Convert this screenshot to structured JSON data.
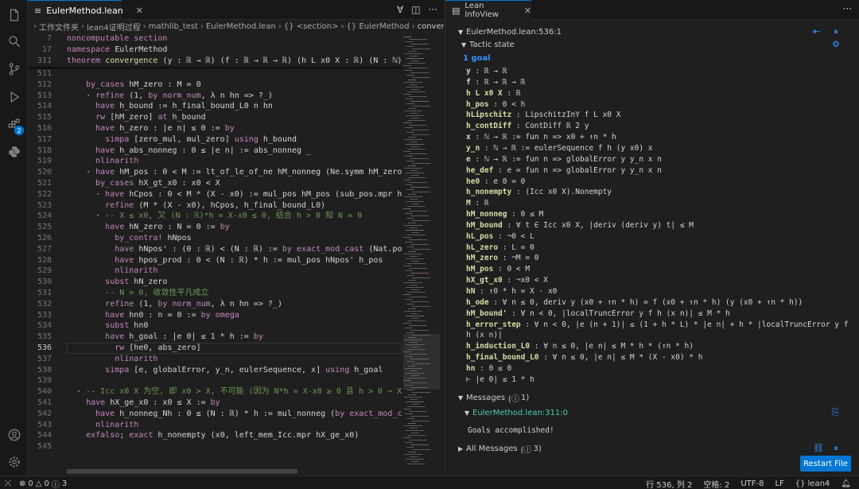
{
  "editor": {
    "tab_label": "EulerMethod.lean",
    "breadcrumb": [
      "工作文件夹",
      "lean4证明过程",
      "mathlib_test",
      "EulerMethod.lean",
      "{} <section>",
      "{} EulerMethod",
      "convergence"
    ],
    "sticky_lines": [
      {
        "n": "7",
        "html": "<span class=\"kw\">noncomputable section</span>"
      },
      {
        "n": "17",
        "html": "<span class=\"kw\">namespace</span> EulerMethod"
      },
      {
        "n": "311",
        "html": "<span class=\"kw\">theorem</span> <span class=\"fn\">convergence</span> (y : ℝ → ℝ) (f : ℝ → ℝ → ℝ) (h L x0 X : ℝ) (N : ℕ)"
      }
    ],
    "active_line": "536",
    "lines": [
      {
        "n": "511",
        "html": ""
      },
      {
        "n": "512",
        "html": "    <span class=\"kw\">by_cases</span> hM_zero : M = 0"
      },
      {
        "n": "513",
        "html": "    · <span class=\"kw\">refine</span> (1, <span class=\"kw\">by</span> <span class=\"kw\">norm_num</span>, λ n hn => ?_)"
      },
      {
        "n": "514",
        "html": "      <span class=\"kw\">have</span> h_bound := h_final_bound_L0 n hn"
      },
      {
        "n": "515",
        "html": "      <span class=\"kw\">rw</span> [hM_zero] <span class=\"kw\">at</span> h_bound"
      },
      {
        "n": "516",
        "html": "      <span class=\"kw\">have</span> h_zero : |e n| ≤ 0 := <span class=\"kw\">by</span>"
      },
      {
        "n": "517",
        "html": "        <span class=\"kw\">simpa</span> [zero_mul, mul_zero] <span class=\"kw\">using</span> h_bound"
      },
      {
        "n": "518",
        "html": "      <span class=\"kw\">have</span> h_abs_nonneg : 0 ≤ |e n| := abs_nonneg _"
      },
      {
        "n": "519",
        "html": "      <span class=\"kw\">nlinarith</span>"
      },
      {
        "n": "520",
        "html": "    · <span class=\"kw\">have</span> hM_pos : 0 < M := lt_of_le_of_ne hM_nonneg (Ne.symm hM_zero)"
      },
      {
        "n": "521",
        "html": "      <span class=\"kw\">by_cases</span> hX_gt_x0 : x0 < X"
      },
      {
        "n": "522",
        "html": "      · <span class=\"kw\">have</span> hCpos : 0 < M * (X - x0) := mul_pos hM_pos (sub_pos.mpr hX_gt"
      },
      {
        "n": "523",
        "html": "        <span class=\"kw\">refine</span> (M * (X - x0), hCpos, h_final_bound_L0)"
      },
      {
        "n": "524",
        "html": "      · <span class=\"cm\">-- X ≤ x0, 又 (N : ℝ)*h = X-x0 ≤ 0, 结合 h > 0 知 N = 0</span>"
      },
      {
        "n": "525",
        "html": "        <span class=\"kw\">have</span> hN_zero : N = 0 := <span class=\"kw\">by</span>"
      },
      {
        "n": "526",
        "html": "          <span class=\"kw\">by_contra!</span> hNpos"
      },
      {
        "n": "527",
        "html": "          <span class=\"kw\">have</span> hNpos' : (0 : ℝ) < (N : ℝ) := <span class=\"kw\">by</span> <span class=\"kw\">exact_mod_cast</span> (Nat.pos_o"
      },
      {
        "n": "528",
        "html": "          <span class=\"kw\">have</span> hpos_prod : 0 < (N : ℝ) * h := mul_pos hNpos' h_pos"
      },
      {
        "n": "529",
        "html": "          <span class=\"kw\">nlinarith</span>"
      },
      {
        "n": "530",
        "html": "        <span class=\"kw\">subst</span> hN_zero"
      },
      {
        "n": "531",
        "html": "        <span class=\"cm\">-- N = 0, 收敛性平凡成立</span>"
      },
      {
        "n": "532",
        "html": "        <span class=\"kw\">refine</span> (1, <span class=\"kw\">by</span> <span class=\"kw\">norm_num</span>, λ n hn => ?_)"
      },
      {
        "n": "533",
        "html": "        <span class=\"kw\">have</span> hn0 : n = 0 := <span class=\"kw\">by</span> <span class=\"kw\">omega</span>"
      },
      {
        "n": "534",
        "html": "        <span class=\"kw\">subst</span> hn0"
      },
      {
        "n": "535",
        "html": "        <span class=\"kw\">have</span> h_goal : |e 0| ≤ 1 * h := <span class=\"kw\">by</span>"
      },
      {
        "n": "536",
        "html": "          <span class=\"kw\">rw</span> [he0, abs_zero]"
      },
      {
        "n": "537",
        "html": "          <span class=\"kw\">nlinarith</span>"
      },
      {
        "n": "538",
        "html": "        <span class=\"kw\">simpa</span> [e, globalError, y_n, eulerSequence, x] <span class=\"kw\">using</span> h_goal"
      },
      {
        "n": "539",
        "html": ""
      },
      {
        "n": "540",
        "html": "  · <span class=\"cm\">-- Icc x0 X 为空, 即 x0 > X, 不可能 (因为 N*h = X-x0 ≥ 0 且 h > 0 ⇒ X ≥ x</span>"
      },
      {
        "n": "541",
        "html": "    <span class=\"kw\">have</span> hX_ge_x0 : x0 ≤ X := <span class=\"kw\">by</span>"
      },
      {
        "n": "542",
        "html": "      <span class=\"kw\">have</span> h_nonneg_Nh : 0 ≤ (N : ℝ) * h := mul_nonneg (<span class=\"kw\">by</span> <span class=\"kw\">exact_mod_cast</span> Na"
      },
      {
        "n": "543",
        "html": "      <span class=\"kw\">nlinarith</span>"
      },
      {
        "n": "544",
        "html": "    <span class=\"kw\">exfalso</span>; <span class=\"kw\">exact</span> h_nonempty (x0, left_mem_Icc.mpr hX_ge_x0)"
      },
      {
        "n": "545",
        "html": ""
      }
    ]
  },
  "infoview": {
    "tab_label": "Lean InfoView",
    "location": "EulerMethod.lean:536:1",
    "tactic_state": "Tactic state",
    "goal_count": "1 goal",
    "hyps": [
      {
        "name": "y",
        "type": " : ℝ → ℝ"
      },
      {
        "name": "f",
        "type": " : ℝ → ℝ → ℝ"
      },
      {
        "name": "h L x0 X",
        "type": " : ℝ"
      },
      {
        "name": "h_pos",
        "type": " : 0 < h"
      },
      {
        "name": "hLipschitz",
        "type": " : LipschitzInY f L x0 X"
      },
      {
        "name": "h_contDiff",
        "type": " : ContDiff ℝ 2 y"
      },
      {
        "name": "x",
        "type": " : ℕ → ℝ := fun n => x0 + ↑n * h"
      },
      {
        "name": "y_n",
        "type": " : ℕ → ℝ := eulerSequence f h (y x0) x"
      },
      {
        "name": "e",
        "type": " : ℕ → ℝ := fun n => globalError y y_n x n"
      },
      {
        "name": "he_def",
        "type": " : e = fun n => globalError y y_n x n"
      },
      {
        "name": "he0",
        "type": " : e 0 = 0"
      },
      {
        "name": "h_nonempty",
        "type": " : (Icc x0 X).Nonempty"
      },
      {
        "name": "M",
        "type": " : ℝ"
      },
      {
        "name": "hM_nonneg",
        "type": " : 0 ≤ M"
      },
      {
        "name": "hM_bound",
        "type": " : ∀ t ∈ Icc x0 X, |deriv (deriv y) t| ≤ M"
      },
      {
        "name": "hL_pos",
        "type": " : ¬0 < L"
      },
      {
        "name": "hL_zero",
        "type": " : L = 0"
      },
      {
        "name": "hM_zero",
        "type": " : ¬M = 0"
      },
      {
        "name": "hM_pos",
        "type": " : 0 < M"
      },
      {
        "name": "hX_gt_x0",
        "type": " : ¬x0 < X"
      },
      {
        "name": "hN",
        "type": " : ↑0 * h = X - x0"
      },
      {
        "name": "h_ode",
        "type": " : ∀ n ≤ 0, deriv y (x0 + ↑n * h) = f (x0 + ↑n * h) (y (x0 + ↑n * h))"
      },
      {
        "name": "hM_bound'",
        "type": " : ∀ n < 0, |localTruncError y f h (x n)| ≤ M * h"
      },
      {
        "name": "h_error_step",
        "type": " : ∀ n < 0, |e (n + 1)| ≤ (1 + h * L) * |e n| + h * |localTruncError y f"
      },
      {
        "name": "",
        "type": "h (x n)|"
      },
      {
        "name": "h_induction_L0",
        "type": " : ∀ n ≤ 0, |e n| ≤ M * h * (↑n * h)"
      },
      {
        "name": "h_final_bound_L0",
        "type": " : ∀ n ≤ 0, |e n| ≤ M * (X - x0) * h"
      },
      {
        "name": "hn",
        "type": " : 0 ≤ 0"
      },
      {
        "name": "⊢",
        "type": " |e 0| ≤ 1 * h"
      }
    ],
    "messages_label": "Messages",
    "messages_count": "1",
    "message_location": "EulerMethod.lean:311:0",
    "message_text": "Goals accomplished!",
    "all_messages_label": "All Messages",
    "all_messages_count": "3",
    "restart_label": "Restart File"
  },
  "status": {
    "errors": "0",
    "warnings": "0",
    "info": "3",
    "position": "行 536, 列 2",
    "spaces": "空格: 2",
    "encoding": "UTF-8",
    "eol": "LF",
    "language": "lean4"
  },
  "activity": {
    "badge": "2"
  },
  "colors": {
    "accent": "#0078d4",
    "keyword": "#c586c0",
    "hyp": "#dcdcaa",
    "goal": "#3794ff"
  }
}
